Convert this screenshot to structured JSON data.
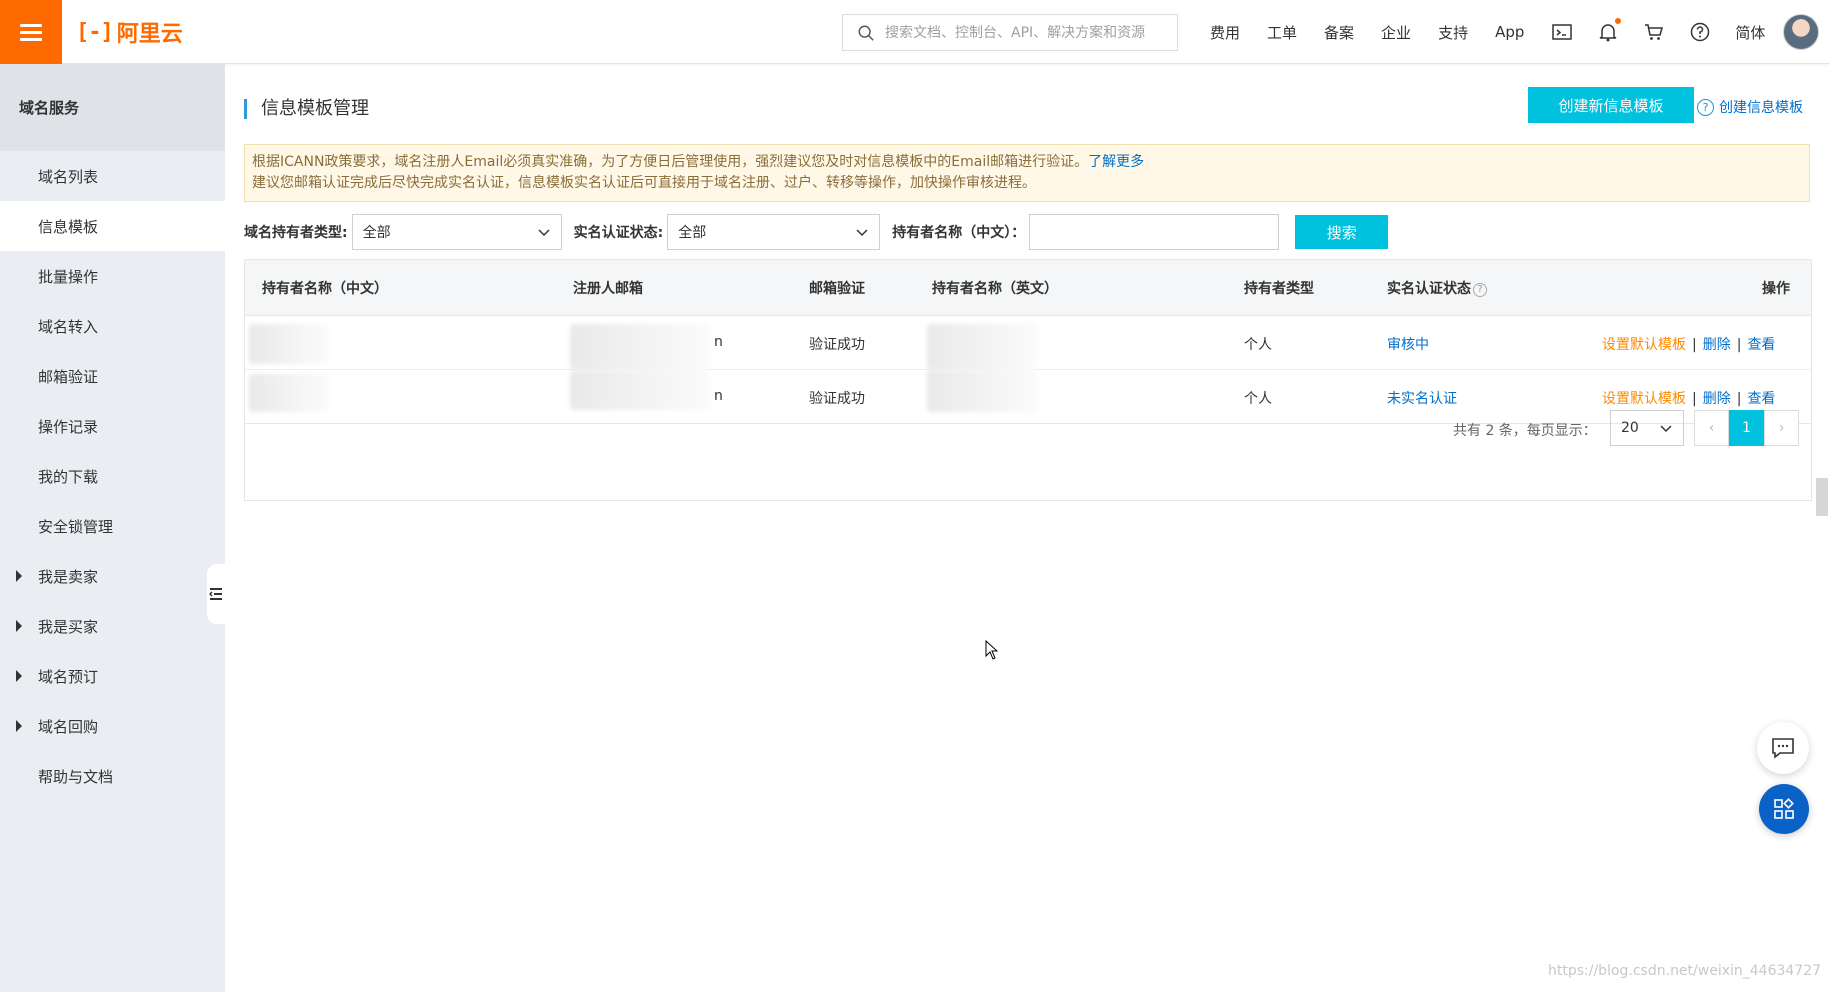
{
  "header": {
    "brand": "阿里云",
    "brand_mark": "[-]",
    "search_placeholder": "搜索文档、控制台、API、解决方案和资源",
    "nav": [
      "费用",
      "工单",
      "备案",
      "企业",
      "支持",
      "App"
    ],
    "language": "简体",
    "accent": "#ff6a00"
  },
  "sidebar": {
    "title": "域名服务",
    "items": [
      {
        "label": "域名列表"
      },
      {
        "label": "信息模板"
      },
      {
        "label": "批量操作"
      },
      {
        "label": "域名转入"
      },
      {
        "label": "邮箱验证"
      },
      {
        "label": "操作记录"
      },
      {
        "label": "我的下载"
      },
      {
        "label": "安全锁管理"
      },
      {
        "label": "我是卖家"
      },
      {
        "label": "我是买家"
      },
      {
        "label": "域名预订"
      },
      {
        "label": "域名回购"
      },
      {
        "label": "帮助与文档"
      }
    ]
  },
  "page": {
    "title": "信息模板管理",
    "create_button": "创建新信息模板",
    "help_link": "创建信息模板",
    "notice_line1": "根据ICANN政策要求，域名注册人Email必须真实准确，为了方便日后管理使用，强烈建议您及时对信息模板中的Email邮箱进行验证。",
    "notice_more": "了解更多",
    "notice_line2": "建议您邮箱认证完成后尽快完成实名认证，信息模板实名认证后可直接用于域名注册、过户、转移等操作，加快操作审核进程。"
  },
  "filters": {
    "owner_type_label": "域名持有者类型:",
    "owner_type_value": "全部",
    "auth_status_label": "实名认证状态:",
    "auth_status_value": "全部",
    "owner_name_label": "持有者名称（中文）：",
    "search_button": "搜索"
  },
  "table": {
    "columns": [
      "持有者名称（中文）",
      "注册人邮箱",
      "邮箱验证",
      "持有者名称（英文）",
      "持有者类型",
      "实名认证状态",
      "操作"
    ],
    "rows": [
      {
        "email_suffix": "n",
        "email_verify": "验证成功",
        "owner_type": "个人",
        "auth_status": "审核中"
      },
      {
        "email_suffix": "n",
        "email_verify": "验证成功",
        "owner_type": "个人",
        "auth_status": "未实名认证"
      }
    ],
    "ops": {
      "set_default": "设置默认模板",
      "delete": "删除",
      "view": "查看"
    }
  },
  "pagination": {
    "total_text": "共有 2 条，每页显示：",
    "page_size": "20",
    "current_page": "1"
  },
  "watermark": "https://blog.csdn.net/weixin_44634727"
}
